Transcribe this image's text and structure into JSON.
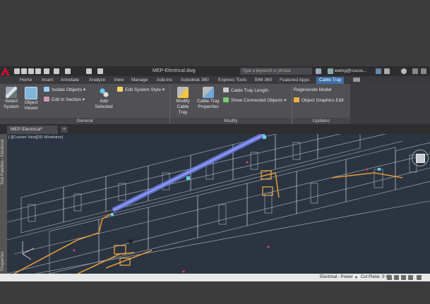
{
  "titlebar": {
    "document_title": "MEP-Electrical.dwg",
    "search_placeholder": "Type a keyword or phrase",
    "user_name": "ewing@cscos..."
  },
  "ribbon_tabs": [
    "Home",
    "Insert",
    "Annotate",
    "Analyze",
    "View",
    "Manage",
    "Add-ins",
    "Autodesk 360",
    "Express Tools",
    "BIM 360",
    "Featured Apps",
    "Cable Tray"
  ],
  "active_tab": "Cable Tray",
  "panels": {
    "general": {
      "label": "General",
      "select_system": "Select System",
      "object_viewer": "Object Viewer",
      "isolate_objects": "Isolate Objects",
      "edit_in_section": "Edit In Section",
      "add_selected": "Add Selected",
      "edit_system_style": "Edit System Style"
    },
    "modify": {
      "label": "Modify",
      "modify_cable_tray": "Modify Cable Tray",
      "cable_tray_properties": "Cable Tray Properties",
      "cable_tray_length": "Cable Tray Length",
      "show_connected_objects": "Show Connected Objects"
    },
    "updates": {
      "label": "Updates",
      "regenerate_model": "Regenerate Model",
      "object_graphics_edit": "Object Graphics Edit"
    }
  },
  "document_tab": "MEP-Electrical*",
  "viewport": {
    "view_label": "[-][Custom View][3D Wireframe]",
    "left_palette_top": "Tool Palettes - Electrical",
    "left_palette_bottom": "Properties"
  },
  "statusbar": {
    "system": "Electrical - Power",
    "cut_plane": "Cut Plane: 3'-6\""
  },
  "colors": {
    "accent_tab": "#3d6fa8",
    "duct_blue": "#6d7dea",
    "tray_orange": "#e09a3c",
    "wire_white": "#d8dde4"
  }
}
